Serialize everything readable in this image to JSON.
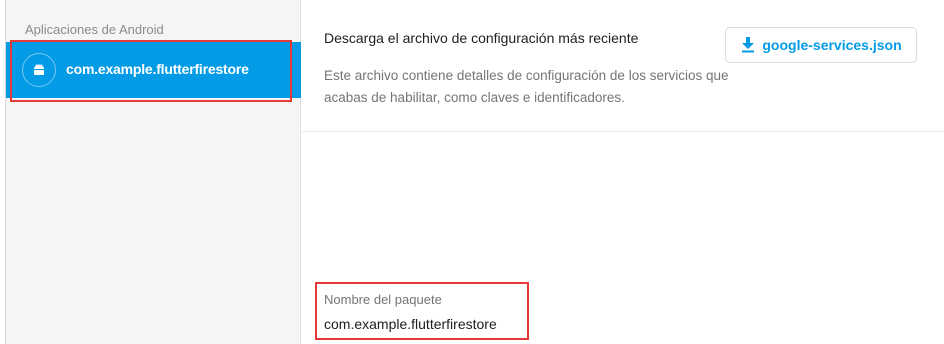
{
  "sidebar": {
    "heading": "Aplicaciones de Android",
    "selected_app": {
      "label": "com.example.flutterfirestore",
      "icon": "android-icon"
    }
  },
  "config_card": {
    "title": "Descarga el archivo de configuración más reciente",
    "description": "Este archivo contiene detalles de configuración de los servicios que acabas de habilitar, como claves e identificadores.",
    "download_button": {
      "label": "google-services.json",
      "icon": "download-icon"
    }
  },
  "package": {
    "label": "Nombre del paquete",
    "value": "com.example.flutterfirestore"
  },
  "colors": {
    "accent": "#039be5",
    "highlight": "#e53935",
    "sidebar_bg": "#f5f5f5"
  }
}
